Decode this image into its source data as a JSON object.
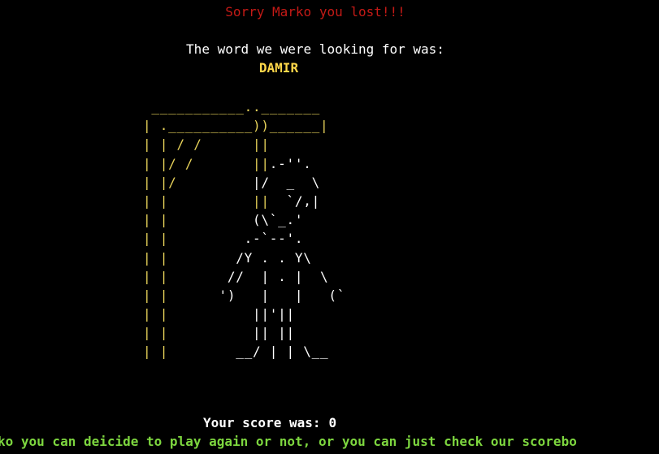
{
  "colors": {
    "background": "#000000",
    "lost_message": "#c41a16",
    "secret_word": "#ffd84a",
    "gallows": "#e8d35a",
    "prompt": "#7dd63f"
  },
  "lost_message": "Sorry Marko you lost!!!",
  "word_intro": "The word we were looking for was:",
  "secret_word": "DAMIR",
  "hangman_art": [
    [
      {
        "t": " ___________.._______",
        "c": "g"
      }
    ],
    [
      {
        "t": "| .__________))______|",
        "c": "g"
      }
    ],
    [
      {
        "t": "| | / /      ||",
        "c": "g"
      }
    ],
    [
      {
        "t": "| |/ /       ||",
        "c": "g"
      },
      {
        "t": ".-''.",
        "c": "m"
      }
    ],
    [
      {
        "t": "| |/         ",
        "c": "g"
      },
      {
        "t": "|/  _  \\",
        "c": "m"
      }
    ],
    [
      {
        "t": "| |          ||",
        "c": "g"
      },
      {
        "t": "  `/,|",
        "c": "m"
      }
    ],
    [
      {
        "t": "| |          ",
        "c": "g"
      },
      {
        "t": "(\\`_.'",
        "c": "m"
      }
    ],
    [
      {
        "t": "| |         ",
        "c": "g"
      },
      {
        "t": ".-`--'.",
        "c": "m"
      }
    ],
    [
      {
        "t": "| |        ",
        "c": "g"
      },
      {
        "t": "/Y . . Y\\",
        "c": "m"
      }
    ],
    [
      {
        "t": "| |       ",
        "c": "g"
      },
      {
        "t": "//  | . |  \\",
        "c": "m"
      }
    ],
    [
      {
        "t": "| |      ",
        "c": "g"
      },
      {
        "t": "')   |   |   (`",
        "c": "m"
      }
    ],
    [
      {
        "t": "| |          ",
        "c": "g"
      },
      {
        "t": "||'||",
        "c": "m"
      }
    ],
    [
      {
        "t": "| |          ",
        "c": "g"
      },
      {
        "t": "|| ||",
        "c": "m"
      }
    ],
    [
      {
        "t": "| |        ",
        "c": "g"
      },
      {
        "t": "__/ | | \\__",
        "c": "m"
      }
    ]
  ],
  "score_label": "Your score was:",
  "score_value": "0",
  "play_again_prompt": "ko you can deicide to play again or not, or you can just check our scorebo"
}
